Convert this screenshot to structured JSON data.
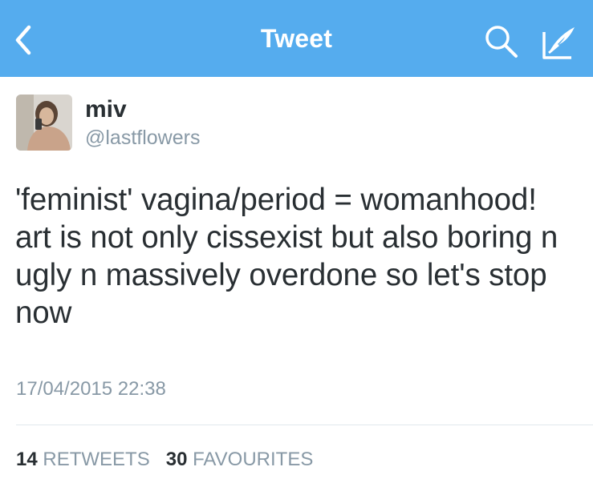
{
  "nav": {
    "title": "Tweet",
    "back_icon": "chevron-left-icon",
    "search_icon": "search-icon",
    "compose_icon": "compose-icon",
    "color": "#55acee"
  },
  "tweet": {
    "author_name": "miv",
    "author_handle": "@lastflowers",
    "text": "'feminist' vagina/period = womanhood! art is not only cissexist but also boring n ugly n massively overdone so let's stop now",
    "timestamp": "17/04/2015 22:38",
    "retweets_count": "14",
    "retweets_label": "RETWEETS",
    "favourites_count": "30",
    "favourites_label": "FAVOURITES"
  }
}
